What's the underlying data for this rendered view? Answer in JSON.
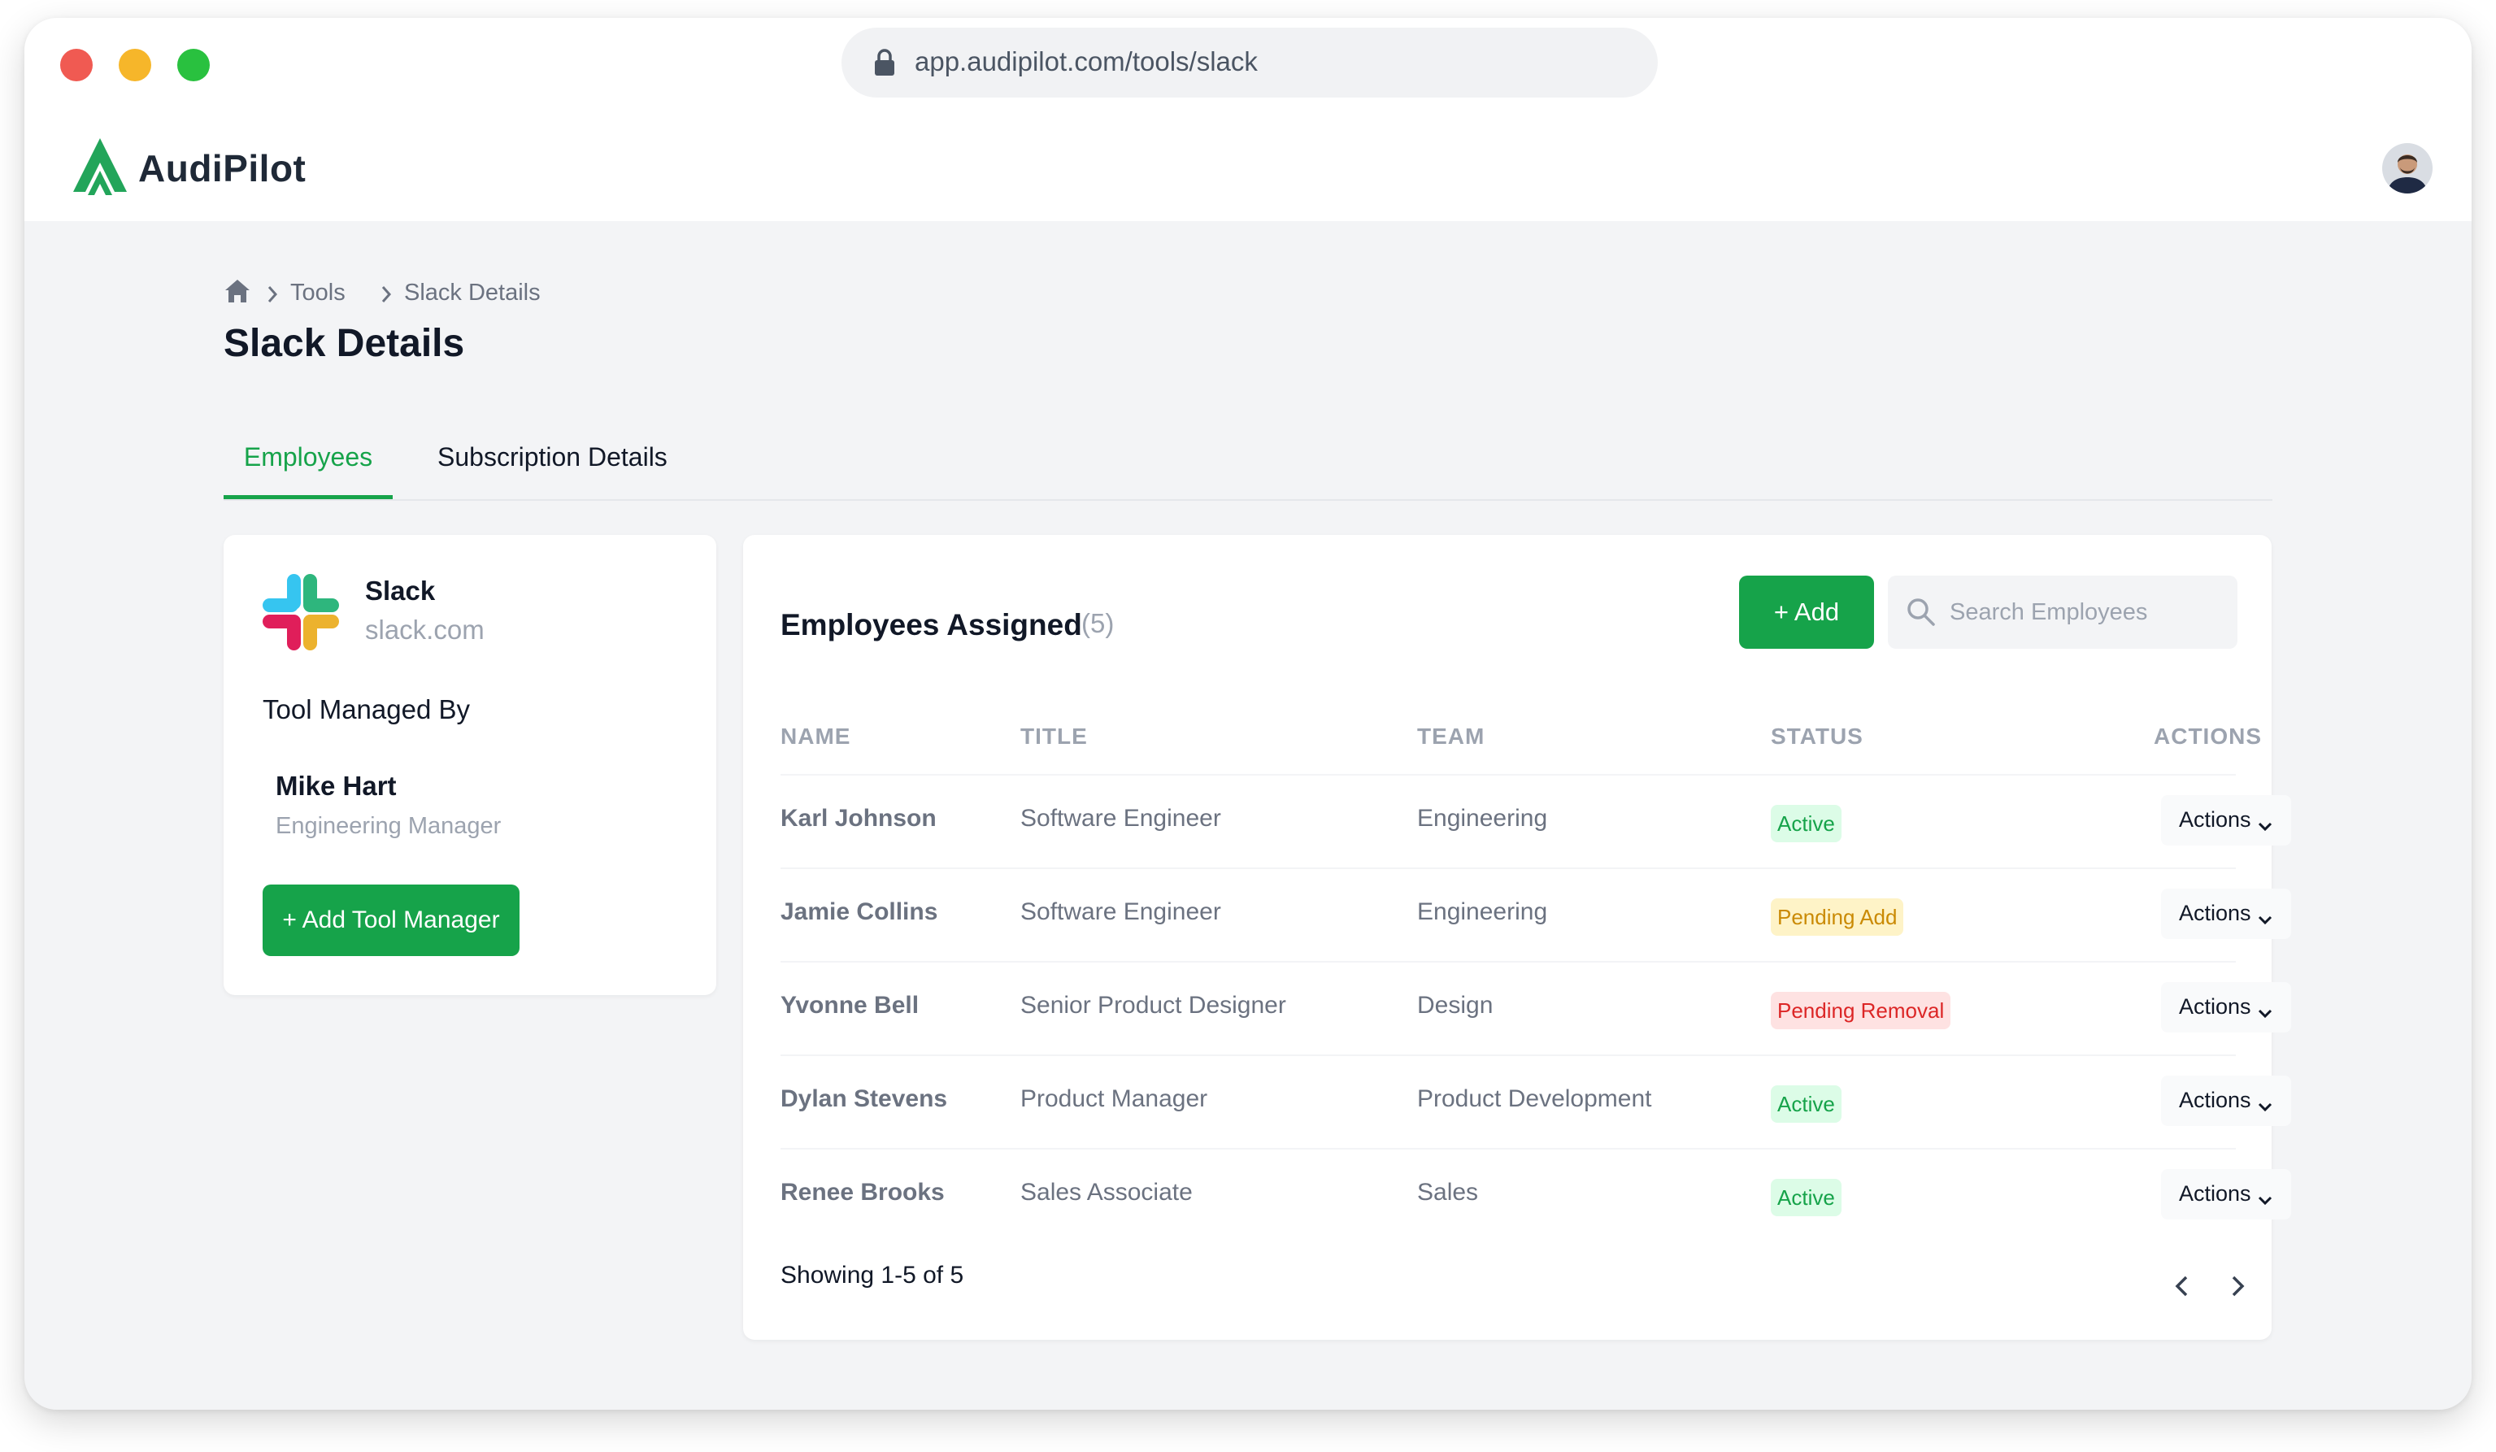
{
  "browser": {
    "url": "app.audipilot.com/tools/slack"
  },
  "header": {
    "brand": "AudiPilot",
    "brand_color": "#16a34a"
  },
  "breadcrumb": {
    "items": [
      "Tools",
      "Slack Details"
    ]
  },
  "page": {
    "title": "Slack Details"
  },
  "tabs": [
    {
      "label": "Employees",
      "active": true
    },
    {
      "label": "Subscription Details",
      "active": false
    }
  ],
  "tool": {
    "name": "Slack",
    "domain": "slack.com",
    "managed_by_label": "Tool Managed By",
    "manager": {
      "name": "Mike Hart",
      "role": "Engineering Manager"
    },
    "add_manager_label": "+ Add Tool Manager"
  },
  "employees": {
    "heading": "Employees Assigned",
    "count": "(5)",
    "add_label": "+ Add",
    "search_placeholder": "Search Employees",
    "columns": [
      "NAME",
      "TITLE",
      "TEAM",
      "STATUS",
      "ACTIONS"
    ],
    "rows": [
      {
        "name": "Karl Johnson",
        "title": "Software Engineer",
        "team": "Engineering",
        "status": "Active",
        "action": "Actions"
      },
      {
        "name": "Jamie Collins",
        "title": "Software Engineer",
        "team": "Engineering",
        "status": "Pending Add",
        "action": "Actions"
      },
      {
        "name": "Yvonne Bell",
        "title": "Senior Product Designer",
        "team": "Design",
        "status": "Pending Removal",
        "action": "Actions"
      },
      {
        "name": "Dylan Stevens",
        "title": "Product Manager",
        "team": "Product Development",
        "status": "Active",
        "action": "Actions"
      },
      {
        "name": "Renee Brooks",
        "title": "Sales Associate",
        "team": "Sales",
        "status": "Active",
        "action": "Actions"
      }
    ],
    "showing": "Showing 1-5 of 5"
  },
  "status_colors": {
    "Active": "#16a34a",
    "Pending Add": "#ca8a04",
    "Pending Removal": "#dc2626"
  },
  "icons": [
    "lock-icon",
    "audipilot-logo-icon",
    "avatar",
    "home-icon",
    "chevron-right-icon",
    "slack-logo-icon",
    "search-icon",
    "chevron-down-icon",
    "chevron-left-icon"
  ]
}
